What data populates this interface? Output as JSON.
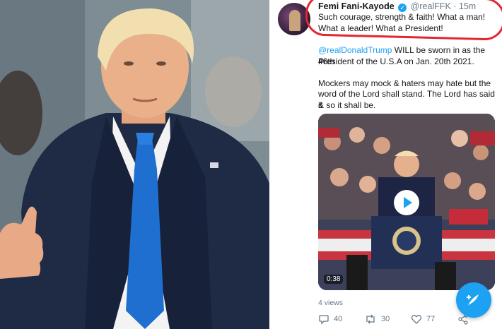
{
  "tweet": {
    "author_name": "Femi Fani-Kayode",
    "handle": "@realFFK",
    "separator": " · ",
    "time": "15m",
    "text_line1": "Such courage, strength & faith! What a man!",
    "text_line2": "What a leader! What a President!",
    "mention": "@realDonaldTrump",
    "text_line3_rest": " WILL be sworn in as the 46th",
    "text_line4": "President of the U.S.A on Jan. 20th 2021.",
    "text_line5": "Mockers may mock & haters may hate but the",
    "text_line6": "word of the Lord shall stand. The Lord has said it",
    "text_line7": "& so it shall be.",
    "video_duration": "0:38",
    "views": "4 views",
    "reply_count": "40",
    "retweet_count": "30",
    "like_count": "77"
  },
  "icons": {
    "verified": "verified-badge-icon",
    "play": "play-icon",
    "reply": "reply-icon",
    "retweet": "retweet-icon",
    "like": "heart-icon",
    "share": "share-icon",
    "compose": "compose-tweet-icon"
  },
  "colors": {
    "accent": "#1da1f2",
    "highlight_ring": "#e3262f",
    "text": "#14171a",
    "muted": "#657786"
  }
}
